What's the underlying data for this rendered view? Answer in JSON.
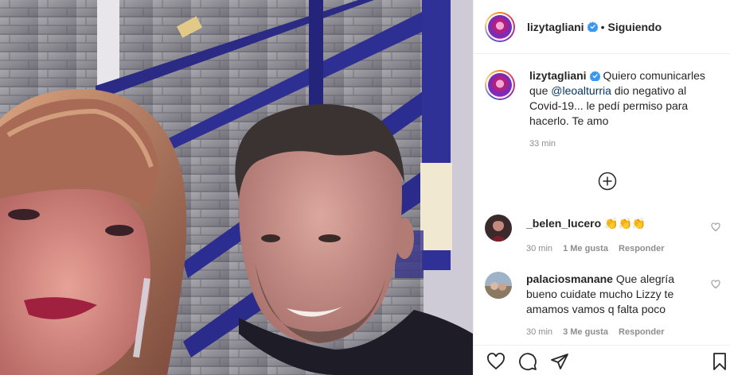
{
  "post": {
    "username": "lizytagliani",
    "separator": "•",
    "follow_label": "Siguiendo",
    "caption": {
      "username": "lizytagliani",
      "text_before": " Quiero comunicarles que ",
      "mention": "@leoalturria",
      "text_after": " dio negativo al Covid-19... le pedí permiso para hacerlo. Te amo"
    },
    "caption_time": "33 min"
  },
  "icons": {
    "verified": "verified-badge-icon",
    "more": "plus-circle-icon",
    "heart": "heart-icon",
    "comment": "comment-icon",
    "share": "paper-plane-icon",
    "save": "bookmark-icon"
  },
  "comments": [
    {
      "username": "_belen_lucero",
      "text": " 👏👏👏",
      "time": "30 min",
      "likes": "1 Me gusta",
      "reply": "Responder"
    },
    {
      "username": "palaciosmanane",
      "text": " Que alegría bueno cuidate mucho Lizzy te amamos vamos q falta poco",
      "time": "30 min",
      "likes": "3 Me gusta",
      "reply": "Responder"
    }
  ],
  "colors": {
    "verified": "#3897f0",
    "mention": "#00376b",
    "secondary_text": "#8e8e8e",
    "border": "#efefef"
  }
}
